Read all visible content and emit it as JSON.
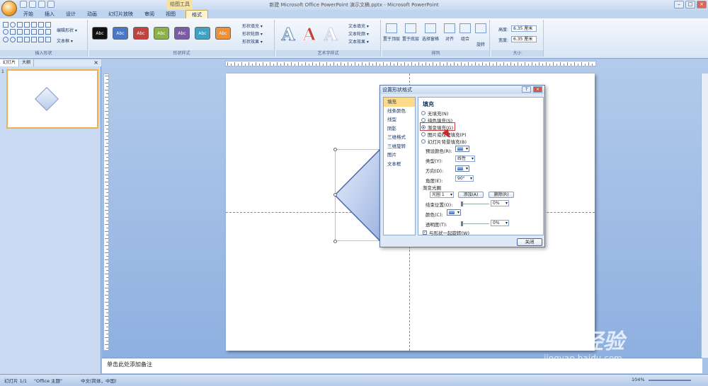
{
  "window": {
    "title": "新建 Microsoft Office PowerPoint 演示文稿.pptx - Microsoft PowerPoint",
    "context_tool_label": "绘图工具",
    "buttons": [
      "–",
      "□",
      "×"
    ]
  },
  "tabs": [
    "开始",
    "插入",
    "设计",
    "动画",
    "幻灯片放映",
    "审阅",
    "视图",
    "格式"
  ],
  "active_tab": "格式",
  "ribbon": {
    "insert_shapes": {
      "label": "插入形状",
      "edit_shape": "编辑形状 ▾",
      "textbox": "文本框 ▾"
    },
    "shape_styles": {
      "label": "形状样式",
      "style_text": "Abc",
      "style_colors": [
        "#111111",
        "#4a78c4",
        "#c6413b",
        "#8cb04a",
        "#7d5aa6",
        "#3fa1c4",
        "#f08f34"
      ],
      "shape_fill": "形状填充 ▾",
      "shape_outline": "形状轮廓 ▾",
      "shape_effects": "形状效果 ▾"
    },
    "wordart": {
      "label": "艺术字样式",
      "letter": "A",
      "text_fill": "文本填充 ▾",
      "text_outline": "文本轮廓 ▾",
      "text_effects": "文本效果 ▾"
    },
    "arrange": {
      "label": "排列",
      "bring_front": "置于顶层",
      "send_back": "置于底层",
      "selection_pane": "选择窗格",
      "align": "对齐",
      "group": "组合",
      "rotate": "旋转"
    },
    "size": {
      "label": "大小",
      "height_label": "高度:",
      "height_value": "6.35 厘米",
      "width_label": "宽度:",
      "width_value": "6.35 厘米"
    }
  },
  "left_panel": {
    "tabs": [
      "幻灯片",
      "大纲"
    ],
    "close": "×",
    "slide_number": "1"
  },
  "dialog": {
    "title": "设置形状格式",
    "title_buttons": [
      "?",
      "×"
    ],
    "nav": [
      "填充",
      "线条颜色",
      "线型",
      "阴影",
      "三维格式",
      "三维旋转",
      "图片",
      "文本框"
    ],
    "active_nav": "填充",
    "heading": "填充",
    "fill_options": [
      "无填充(N)",
      "纯色填充(S)",
      "渐变填充(G)",
      "图片或纹理填充(P)",
      "幻灯片背景填充(B)"
    ],
    "selected_fill": "渐变填充(G)",
    "preset_colors_label": "预设颜色(R):",
    "type_label": "类型(Y):",
    "type_value": "线性",
    "direction_label": "方向(D):",
    "angle_label": "角度(E):",
    "angle_value": "90°",
    "gradient_stops_label": "渐变光圈",
    "stop_value": "光圈 1",
    "add_button": "添加(A)",
    "delete_button": "删除(R)",
    "stop_position_label": "结束位置(O):",
    "stop_position_value": "0%",
    "color_label": "颜色(C):",
    "transparency_label": "透明度(T):",
    "transparency_value": "0%",
    "rotate_with_shape": "与形状一起旋转(W)",
    "close_button": "关闭"
  },
  "notes_placeholder": "单击此处添加备注",
  "status": {
    "slide_info": "幻灯片 1/1",
    "theme": "\"Office 主题\"",
    "language": "中文(简体，中国)",
    "zoom": "104%"
  },
  "watermark": {
    "main": "Bai 经验",
    "sub": "jingyan.baidu.com"
  }
}
